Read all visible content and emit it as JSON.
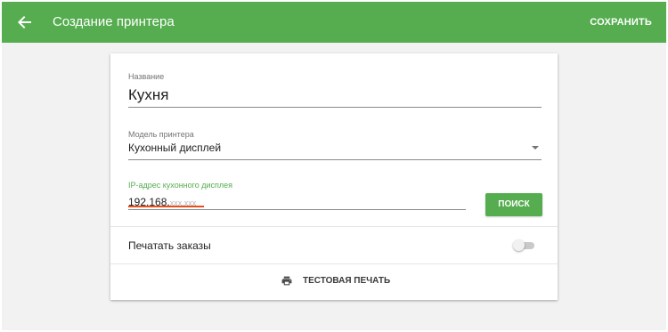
{
  "colors": {
    "accent": "#55ad4f",
    "error_underline": "#e8501d",
    "background": "#f2f2f2"
  },
  "appbar": {
    "back_icon": "arrow-left-icon",
    "title": "Создание принтера",
    "save_label": "СОХРАНИТЬ"
  },
  "form": {
    "name": {
      "label": "Название",
      "value": "Кухня"
    },
    "model": {
      "label": "Модель принтера",
      "value": "Кухонный дисплей",
      "dropdown_icon": "caret-down-icon"
    },
    "ip": {
      "label": "IP-адрес кухонного дисплея",
      "value": "192.168.",
      "placeholder": "xxx.xxx"
    },
    "search_label": "ПОИСК",
    "print_orders": {
      "label": "Печатать заказы",
      "enabled": false
    },
    "test_print": {
      "icon": "printer-icon",
      "label": "ТЕСТОВАЯ ПЕЧАТЬ"
    }
  }
}
